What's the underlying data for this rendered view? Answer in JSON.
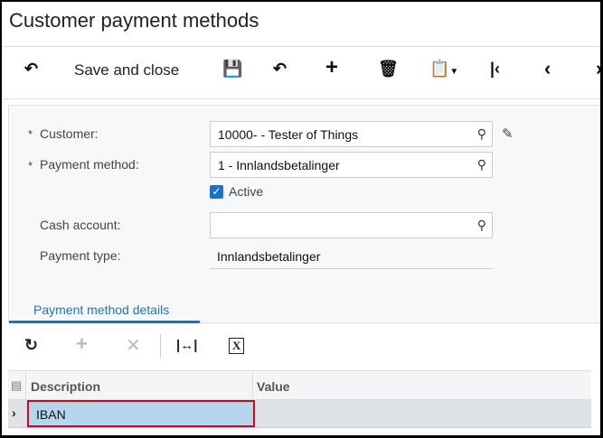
{
  "title": "Customer payment methods",
  "toolbar": {
    "save_close": "Save and close",
    "icons": [
      "back-arrow",
      "save",
      "undo",
      "add",
      "delete",
      "clipboard-dropdown",
      "first",
      "previous",
      "next"
    ]
  },
  "form": {
    "customer": {
      "label": "Customer:",
      "value": "10000- - Tester of Things",
      "required": "*"
    },
    "payment_method": {
      "label": "Payment method:",
      "value": "1 - Innlandsbetalinger",
      "required": "*"
    },
    "active": {
      "label": "Active",
      "checked": true
    },
    "cash_account": {
      "label": "Cash account:",
      "value": ""
    },
    "payment_type": {
      "label": "Payment type:",
      "value": "Innlandsbetalinger"
    }
  },
  "tabs": [
    {
      "label": "Payment method details",
      "active": true
    }
  ],
  "grid": {
    "columns": [
      "Description",
      "Value"
    ],
    "rows": [
      {
        "description": "IBAN",
        "value": ""
      }
    ]
  },
  "colors": {
    "accent": "#0b78d0",
    "selection": "#b6d6ee",
    "highlight_border": "#e0001a"
  }
}
